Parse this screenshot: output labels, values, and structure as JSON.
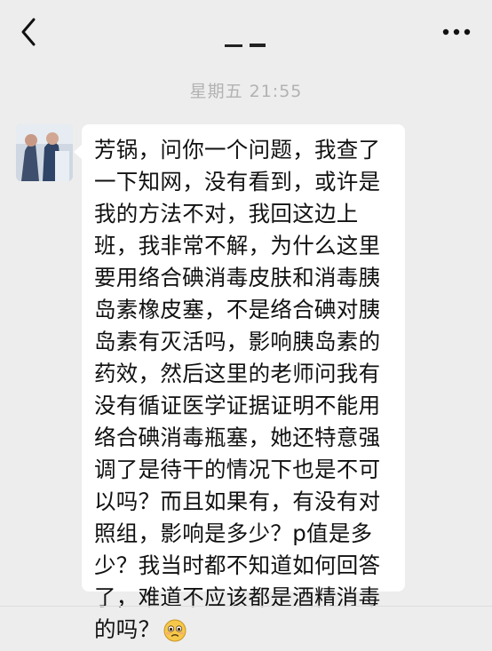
{
  "header": {
    "back_icon": "chevron-left-icon",
    "more_icon": "more-dots-icon"
  },
  "timestamp": "星期五 21:55",
  "message": {
    "sender_avatar": "avatar",
    "text": "芳锅，问你一个问题，我查了一下知网，没有看到，或许是我的方法不对，我回这边上班，我非常不解，为什么这里要用络合碘消毒皮肤和消毒胰岛素橡皮塞，不是络合碘对胰岛素有灭活吗，影响胰岛素的药效，然后这里的老师问我有没有循证医学证据证明不能用络合碘消毒瓶塞，她还特意强调了是待干的情况下也是不可以吗？而且如果有，有没有对照组，影响是多少？p值是多少？我当时都不知道如何回答了，难道不应该都是酒精消毒的吗？",
    "emoji": "worried-face-icon"
  }
}
